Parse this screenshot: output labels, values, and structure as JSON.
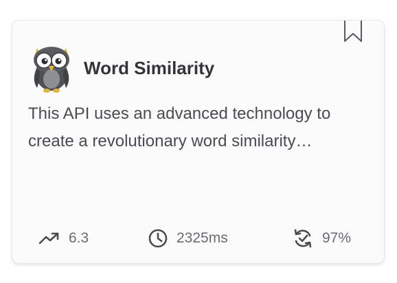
{
  "card": {
    "title": "Word Similarity",
    "description_line1": "This API uses an advanced technology to",
    "description_line2": "create a revolutionary word similarity…",
    "logo_icon": "owl-logo-icon",
    "bookmark_icon": "bookmark-icon"
  },
  "stats": {
    "popularity": {
      "icon": "trending-up-icon",
      "value": "6.3"
    },
    "latency": {
      "icon": "clock-icon",
      "value": "2325ms"
    },
    "success_rate": {
      "icon": "refresh-check-icon",
      "value": "97%"
    }
  },
  "colors": {
    "title": "#333438",
    "text": "#4a4b50",
    "stats": "#6a6b70",
    "card_border": "#e6e6e8",
    "owl_body": "#4f5156",
    "owl_beak": "#e8b83a"
  }
}
